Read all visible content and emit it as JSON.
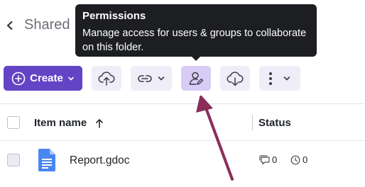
{
  "header": {
    "title": "Shared",
    "back_icon": "chevron-left-icon"
  },
  "tooltip": {
    "title": "Permissions",
    "body": "Manage access for users & groups to collaborate on this folder."
  },
  "toolbar": {
    "create_label": "Create",
    "create_icon": "plus-circle-icon",
    "buttons": [
      {
        "name": "upload",
        "icon": "cloud-upload-icon"
      },
      {
        "name": "link",
        "icon": "link-icon"
      },
      {
        "name": "permissions",
        "icon": "user-edit-icon",
        "active": true
      },
      {
        "name": "download",
        "icon": "cloud-download-icon"
      },
      {
        "name": "more",
        "icon": "more-vertical-icon"
      }
    ],
    "accent_color": "#6344c5"
  },
  "table": {
    "columns": [
      {
        "label": "Item name",
        "sort": "ascending"
      },
      {
        "label": "Status"
      }
    ],
    "rows": [
      {
        "name": "Report.gdoc",
        "icon": "google-doc-icon",
        "comments": "0",
        "history": "0"
      }
    ]
  }
}
